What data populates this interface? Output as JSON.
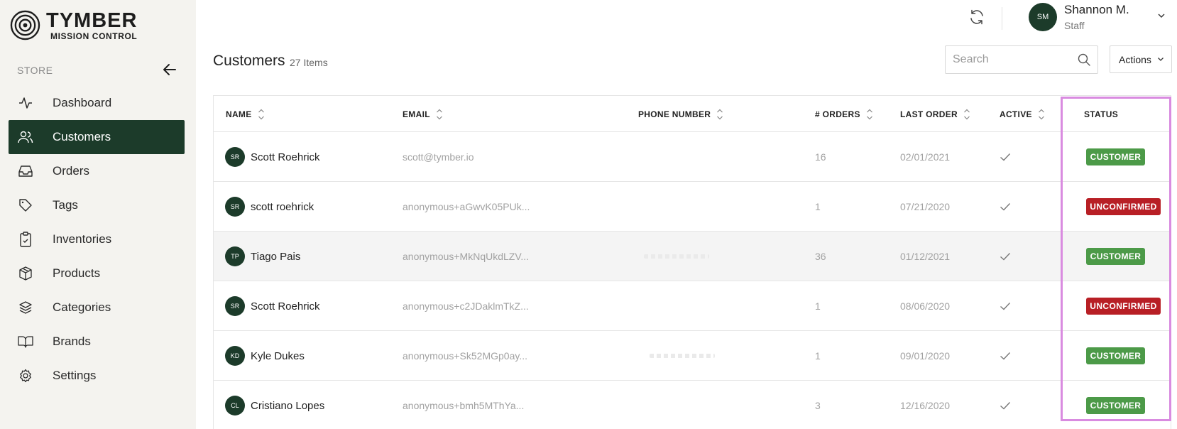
{
  "brand": {
    "title": "TYMBER",
    "subtitle": "MISSION CONTROL"
  },
  "sidebar": {
    "section_label": "STORE",
    "items": [
      {
        "label": "Dashboard",
        "icon": "activity-icon",
        "active": false
      },
      {
        "label": "Customers",
        "icon": "users-icon",
        "active": true
      },
      {
        "label": "Orders",
        "icon": "inbox-icon",
        "active": false
      },
      {
        "label": "Tags",
        "icon": "tag-icon",
        "active": false
      },
      {
        "label": "Inventories",
        "icon": "clipboard-icon",
        "active": false
      },
      {
        "label": "Products",
        "icon": "box-icon",
        "active": false
      },
      {
        "label": "Categories",
        "icon": "layers-icon",
        "active": false
      },
      {
        "label": "Brands",
        "icon": "book-icon",
        "active": false
      },
      {
        "label": "Settings",
        "icon": "gear-icon",
        "active": false
      }
    ]
  },
  "header": {
    "user": {
      "initials": "SM",
      "name": "Shannon M.",
      "role": "Staff"
    }
  },
  "page": {
    "title": "Customers",
    "count": "27 Items",
    "search_placeholder": "Search",
    "actions_label": "Actions"
  },
  "table": {
    "columns": [
      "NAME",
      "EMAIL",
      "PHONE NUMBER",
      "# ORDERS",
      "LAST ORDER",
      "ACTIVE",
      "STATUS"
    ],
    "rows": [
      {
        "initials": "SR",
        "name": "Scott Roehrick",
        "email": "scott@tymber.io",
        "phone": "",
        "orders": "16",
        "last_order": "02/01/2021",
        "active": true,
        "status": "CUSTOMER"
      },
      {
        "initials": "SR",
        "name": "scott roehrick",
        "email": "anonymous+aGwvK05PUk...",
        "phone": "",
        "orders": "1",
        "last_order": "07/21/2020",
        "active": true,
        "status": "UNCONFIRMED"
      },
      {
        "initials": "TP",
        "name": "Tiago Pais",
        "email": "anonymous+MkNqUkdLZV...",
        "phone": "blurred",
        "orders": "36",
        "last_order": "01/12/2021",
        "active": true,
        "status": "CUSTOMER"
      },
      {
        "initials": "SR",
        "name": "Scott Roehrick",
        "email": "anonymous+c2JDaklmTkZ...",
        "phone": "",
        "orders": "1",
        "last_order": "08/06/2020",
        "active": true,
        "status": "UNCONFIRMED"
      },
      {
        "initials": "KD",
        "name": "Kyle Dukes",
        "email": "anonymous+Sk52MGp0ay...",
        "phone": "blurred",
        "orders": "1",
        "last_order": "09/01/2020",
        "active": true,
        "status": "CUSTOMER"
      },
      {
        "initials": "CL",
        "name": "Cristiano Lopes",
        "email": "anonymous+bmh5MThYa...",
        "phone": "",
        "orders": "3",
        "last_order": "12/16/2020",
        "active": true,
        "status": "CUSTOMER"
      }
    ]
  },
  "colors": {
    "brand_green": "#1c3b2a",
    "customer_badge": "#4c9a48",
    "unconfirmed_badge": "#b81f25",
    "highlight": "#d98be0"
  }
}
